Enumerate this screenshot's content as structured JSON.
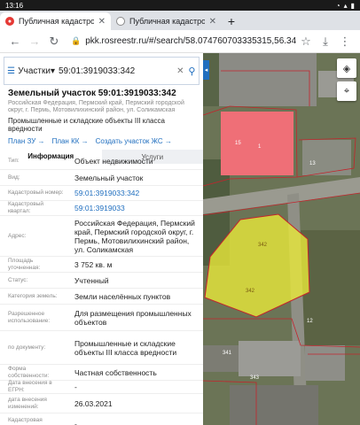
{
  "status_bar": {
    "time": "13:16",
    "battery": "▮"
  },
  "tabs": [
    {
      "title": "Публичная кадастрова",
      "active": true
    },
    {
      "title": "Публичная кадастровая",
      "active": false
    }
  ],
  "address_bar": {
    "url": "pkk.rosreestr.ru/#/search/58.074760703335315,56.34"
  },
  "search": {
    "type_label": "Участки",
    "query": "59:01:3919033:342"
  },
  "object": {
    "title": "Земельный участок 59:01:3919033:342",
    "address_short": "Российская Федерация, Пермский край, Пермский городской округ, г. Пермь, Мотовилихинский район, ул. Соликамская",
    "use": "Промышленные и складские объекты III класса вредности",
    "links": [
      "План ЗУ →",
      "План КК →",
      "Создать участок ЖС →"
    ],
    "tabs": [
      "Информация",
      "Услуги"
    ]
  },
  "rows": [
    {
      "k": "Тип:",
      "v": "Объект недвижимости",
      "h": 20
    },
    {
      "k": "Вид:",
      "v": "Земельный участок",
      "h": 18
    },
    {
      "k": "Кадастровый номер:",
      "v": "59:01:3919033:342",
      "link": true,
      "h": 17
    },
    {
      "k": "Кадастровый квартал:",
      "v": "59:01:3919033",
      "link": true,
      "h": 17
    },
    {
      "k": "Адрес:",
      "v": "Российская Федерация, Пермский край, Пермский городской округ, г. Пермь, Мотовилихинский район, ул. Соликамская",
      "h": 46
    },
    {
      "k": "Площадь уточненная:",
      "v": "3 752 кв. м",
      "h": 18
    },
    {
      "k": "Статус:",
      "v": "Учтенный",
      "h": 18
    },
    {
      "k": "Категория земель:",
      "v": "Земли населённых пунктов",
      "h": 18
    },
    {
      "k": "Разрешенное использование:",
      "v": "Для размещения промышленных объектов",
      "h": 30
    },
    {
      "k": "по документу:",
      "v": "Промышленные и складские объекты III класса вредности",
      "h": 38
    },
    {
      "k": "Форма собственности:",
      "v": "Частная собственность",
      "h": 18
    },
    {
      "k": "Дата внесения в ЕГРН:",
      "v": "-",
      "h": 15
    },
    {
      "k": "дата внесения изменений:",
      "v": "26.03.2021",
      "h": 22
    },
    {
      "k": "Кадастровая стоимость:",
      "v": "-",
      "h": 24
    }
  ],
  "map": {
    "labels": {
      "parcel": "342",
      "parcel_b": "342",
      "bldg": "1",
      "l13": "13",
      "l15": "15",
      "l341": "341",
      "l343": "343",
      "l12": "12"
    },
    "colors": {
      "parcel": "#e8e83a",
      "building": "#ef6f77",
      "boundary": "#c4242c"
    }
  }
}
